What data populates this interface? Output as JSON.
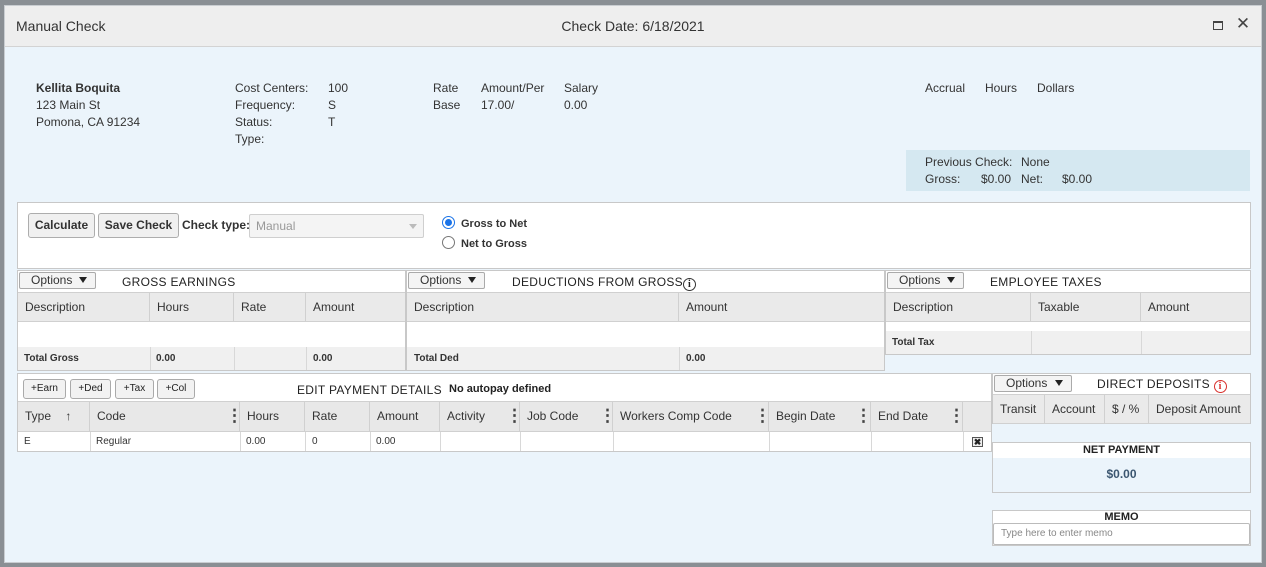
{
  "window": {
    "title": "Manual Check",
    "check_date": "Check Date: 6/18/2021"
  },
  "employee": {
    "name": "Kellita Boquita",
    "address1": "123 Main St",
    "address2": "Pomona, CA 91234"
  },
  "job": {
    "cost_centers_label": "Cost Centers:",
    "cost_centers_value": "100",
    "frequency_label": "Frequency:",
    "frequency_value": "S",
    "status_label": "Status:",
    "status_value": "T",
    "type_label": "Type:"
  },
  "rate": {
    "rate_label": "Rate",
    "amount_per_label": "Amount/Per",
    "salary_label": "Salary",
    "base_label": "Base",
    "base_amount": "17.00/",
    "base_salary": "0.00"
  },
  "accrual": {
    "accrual_label": "Accrual",
    "hours_label": "Hours",
    "dollars_label": "Dollars"
  },
  "previous_check": {
    "label": "Previous Check:",
    "value": "None",
    "gross_label": "Gross:",
    "gross_value": "$0.00",
    "net_label": "Net:",
    "net_value": "$0.00"
  },
  "toolbar": {
    "calculate": "Calculate",
    "save_check": "Save Check",
    "check_type_label": "Check type:",
    "check_type_value": "Manual",
    "gross_to_net": "Gross to Net",
    "net_to_gross": "Net to Gross"
  },
  "options_label": "Options",
  "gross_earnings": {
    "title": "GROSS EARNINGS",
    "columns": [
      "Description",
      "Hours",
      "Rate",
      "Amount"
    ],
    "total_label": "Total Gross",
    "total_hours": "0.00",
    "total_amount": "0.00"
  },
  "deductions": {
    "title": "DEDUCTIONS FROM GROSS",
    "columns": [
      "Description",
      "Amount"
    ],
    "total_label": "Total Ded",
    "total_amount": "0.00"
  },
  "employee_taxes": {
    "title": "EMPLOYEE TAXES",
    "columns": [
      "Description",
      "Taxable",
      "Amount"
    ],
    "total_label": "Total Tax"
  },
  "payment_details": {
    "add_buttons": [
      "+Earn",
      "+Ded",
      "+Tax",
      "+Col"
    ],
    "title": "EDIT PAYMENT DETAILS",
    "autopay": "No autopay defined",
    "columns": [
      "Type",
      "Code",
      "Hours",
      "Rate",
      "Amount",
      "Activity",
      "Job Code",
      "Workers Comp Code",
      "Begin Date",
      "End Date"
    ],
    "sort_arrow": "↑",
    "rows": [
      {
        "type": "E",
        "code": "Regular",
        "hours": "0.00",
        "rate": "0",
        "amount": "0.00",
        "activity": "",
        "job_code": "",
        "workers_comp": "",
        "begin": "",
        "end": ""
      }
    ]
  },
  "direct_deposits": {
    "title": "DIRECT DEPOSITS",
    "columns": [
      "Transit",
      "Account",
      "$ / %",
      "Deposit Amount"
    ]
  },
  "net_payment": {
    "title": "NET PAYMENT",
    "value": "$0.00"
  },
  "memo": {
    "title": "MEMO",
    "placeholder": "Type here to enter memo"
  },
  "icons": {
    "info": "i",
    "close": "✕",
    "remove": "✖"
  }
}
